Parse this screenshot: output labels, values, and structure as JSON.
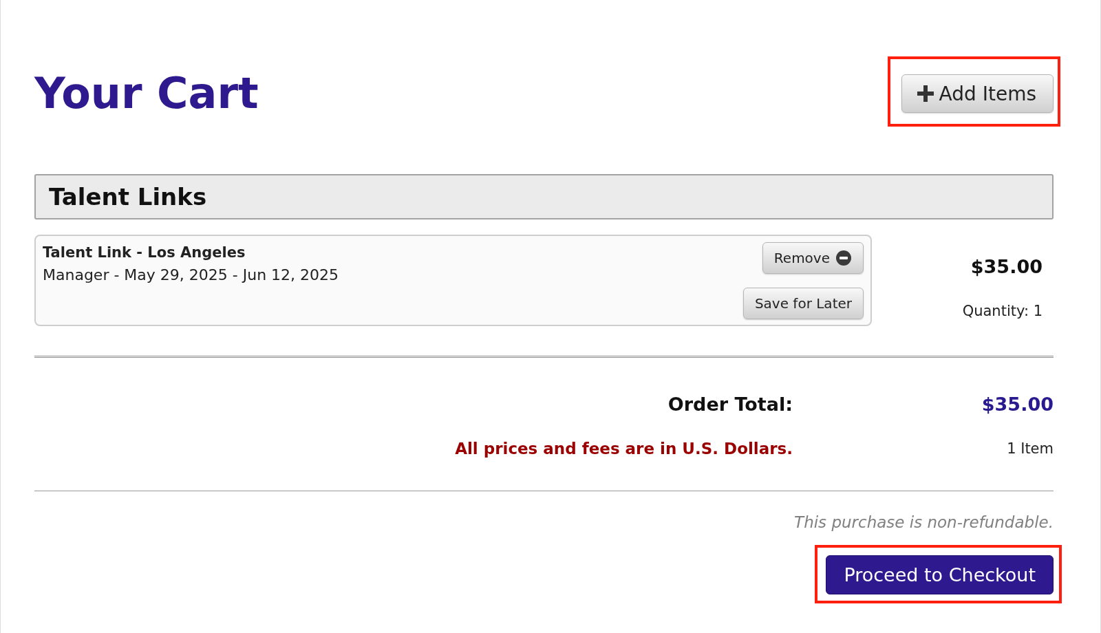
{
  "page": {
    "title": "Your Cart"
  },
  "add_button": {
    "label": "Add Items",
    "highlighted": true
  },
  "sections": [
    {
      "title": "Talent Links",
      "items": [
        {
          "name": "Talent Link - Los Angeles",
          "details": "Manager - May 29, 2025 - Jun 12, 2025",
          "actions": [
            {
              "label": "Remove",
              "kind": "remove"
            },
            {
              "label": "Save for Later",
              "kind": "save"
            }
          ],
          "price": "$35.00",
          "quantity": "Quantity: 1"
        }
      ]
    }
  ],
  "summary": {
    "total_label": "Order Total:",
    "total_value": "$35.00",
    "currency_note": "All prices and fees are in U.S. Dollars.",
    "item_count": "1 Item"
  },
  "refund_note": "This purchase is non-refundable.",
  "checkout_button": {
    "label": "Proceed to Checkout",
    "highlighted": true
  }
}
